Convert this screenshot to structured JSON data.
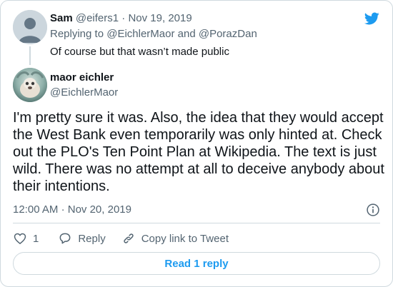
{
  "parent_tweet": {
    "author_name": "Sam",
    "author_handle": "@eifers1",
    "separator": "·",
    "date": "Nov 19, 2019",
    "replying_to_prefix": "Replying to",
    "replying_to_user1": "@EichlerMaor",
    "replying_to_and": "and",
    "replying_to_user2": "@PorazDan",
    "text": "Of course but that wasn’t made public"
  },
  "main_tweet": {
    "author_name": "maor eichler",
    "author_handle": "@EichlerMaor",
    "text": "I'm pretty sure it was. Also, the idea that they would accept the West Bank even temporarily was only hinted at. Check out the PLO's Ten Point Plan at Wikipedia. The text is just wild. There was no attempt at all to deceive anybody about their intentions.",
    "time": "12:00 AM",
    "separator": "·",
    "date": "Nov 20, 2019"
  },
  "actions": {
    "like_count": "1",
    "reply_label": "Reply",
    "copy_link_label": "Copy link to Tweet"
  },
  "read_replies_label": "Read 1 reply",
  "icons": {
    "brand": "twitter-bird-icon",
    "info": "info-icon",
    "like": "heart-icon",
    "reply": "speech-bubble-icon",
    "copy_link": "link-icon"
  },
  "colors": {
    "brand_blue": "#1d9bf0",
    "muted_text": "#536471",
    "border": "#cfd9de"
  }
}
